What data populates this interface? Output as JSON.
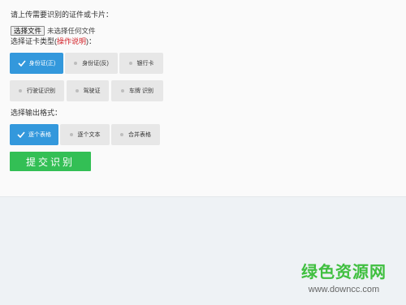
{
  "form": {
    "upload_label": "请上传需要识别的证件或卡片：",
    "file_button": "选择文件",
    "file_status": "未选择任何文件",
    "type_label_prefix": "选择证卡类型(",
    "type_label_hint": "操作说明",
    "type_label_suffix": ")：",
    "card_types": [
      {
        "label": "身份证(正)",
        "selected": true
      },
      {
        "label": "身份证(反)",
        "selected": false
      },
      {
        "label": "银行卡",
        "selected": false
      },
      {
        "label": "行驶证识别",
        "selected": false
      },
      {
        "label": "驾驶证",
        "selected": false
      },
      {
        "label": "车牌 识别",
        "selected": false
      }
    ],
    "output_label": "选择输出格式：",
    "output_formats": [
      {
        "label": "逐个表格",
        "selected": true
      },
      {
        "label": "逐个文本",
        "selected": false
      },
      {
        "label": "合并表格",
        "selected": false
      }
    ],
    "submit_label": "提交识别"
  },
  "watermark": {
    "title": "绿色资源网",
    "url": "www.downcc.com"
  },
  "colors": {
    "selected": "#3398dc",
    "unselected": "#e7e7e7",
    "submit": "#33bf55",
    "hint": "#d3232a",
    "watermark": "#3fbf3f"
  }
}
